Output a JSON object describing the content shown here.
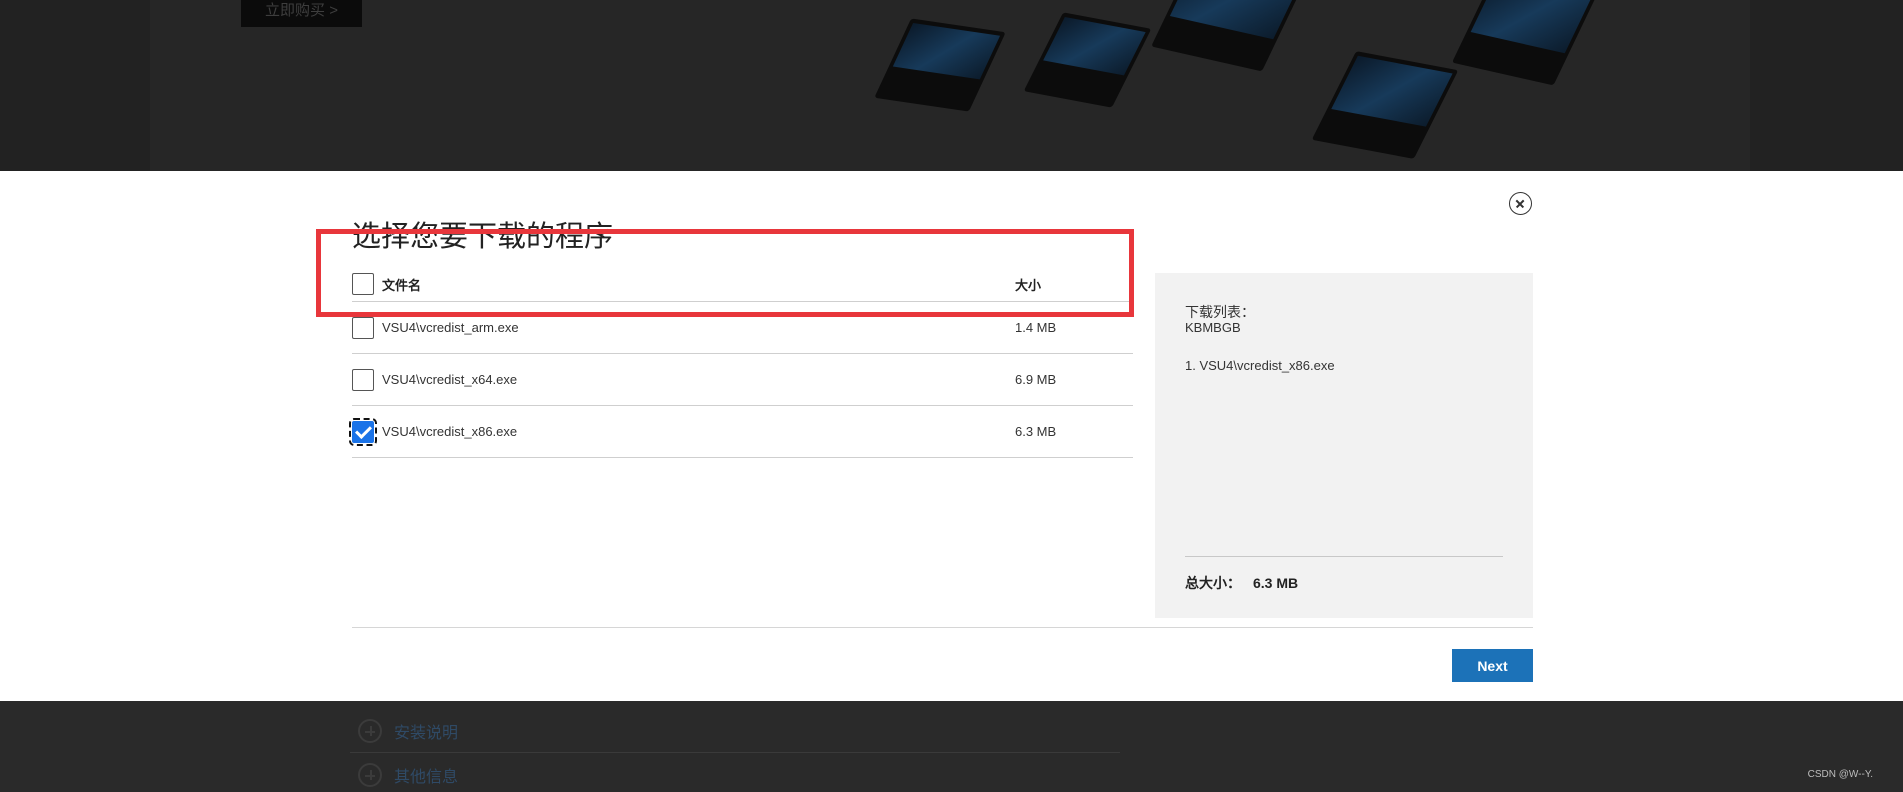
{
  "background": {
    "buy_button_label": "立即购买 >",
    "links": [
      {
        "label": "安装说明"
      },
      {
        "label": "其他信息"
      }
    ],
    "watermark": "CSDN @W--Y."
  },
  "modal": {
    "title": "选择您要下载的程序",
    "table": {
      "header": {
        "name": "文件名",
        "size": "大小"
      },
      "rows": [
        {
          "name": "VSU4\\vcredist_arm.exe",
          "size": "1.4 MB",
          "checked": false
        },
        {
          "name": "VSU4\\vcredist_x64.exe",
          "size": "6.9 MB",
          "checked": false
        },
        {
          "name": "VSU4\\vcredist_x86.exe",
          "size": "6.3 MB",
          "checked": true
        }
      ]
    },
    "summary": {
      "label": "下载列表：",
      "kb": "KBMBGB",
      "items": [
        "1. VSU4\\vcredist_x86.exe"
      ],
      "total_label": "总大小：",
      "total_value": "6.3 MB"
    },
    "next_label": "Next"
  },
  "colors": {
    "accent": "#1c72b8",
    "highlight": "#e8363b",
    "checkbox": "#1a73e8"
  }
}
